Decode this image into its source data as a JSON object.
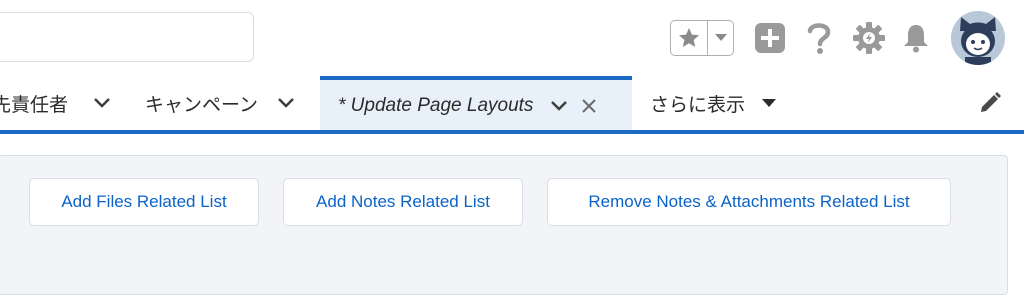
{
  "header": {
    "search": {
      "placeholder": "",
      "value": ""
    },
    "icons": [
      "star-icon",
      "chevron-down-icon",
      "plus-icon",
      "help-icon",
      "setup-gear-icon",
      "bell-icon",
      "avatar"
    ]
  },
  "nav": {
    "tabs": [
      {
        "label": "先責任者",
        "active": false
      },
      {
        "label": "キャンペーン",
        "active": false
      },
      {
        "label": "* Update Page Layouts",
        "active": true
      },
      {
        "label": "さらに表示",
        "active": false
      }
    ]
  },
  "actions": {
    "add_files": "Add Files Related List",
    "add_notes": "Add Notes Related List",
    "remove_notes": "Remove Notes & Attachments Related List"
  },
  "colors": {
    "accent": "#1b6bc4",
    "link": "#0b63c9",
    "icon_gray": "#9a9a9a"
  }
}
